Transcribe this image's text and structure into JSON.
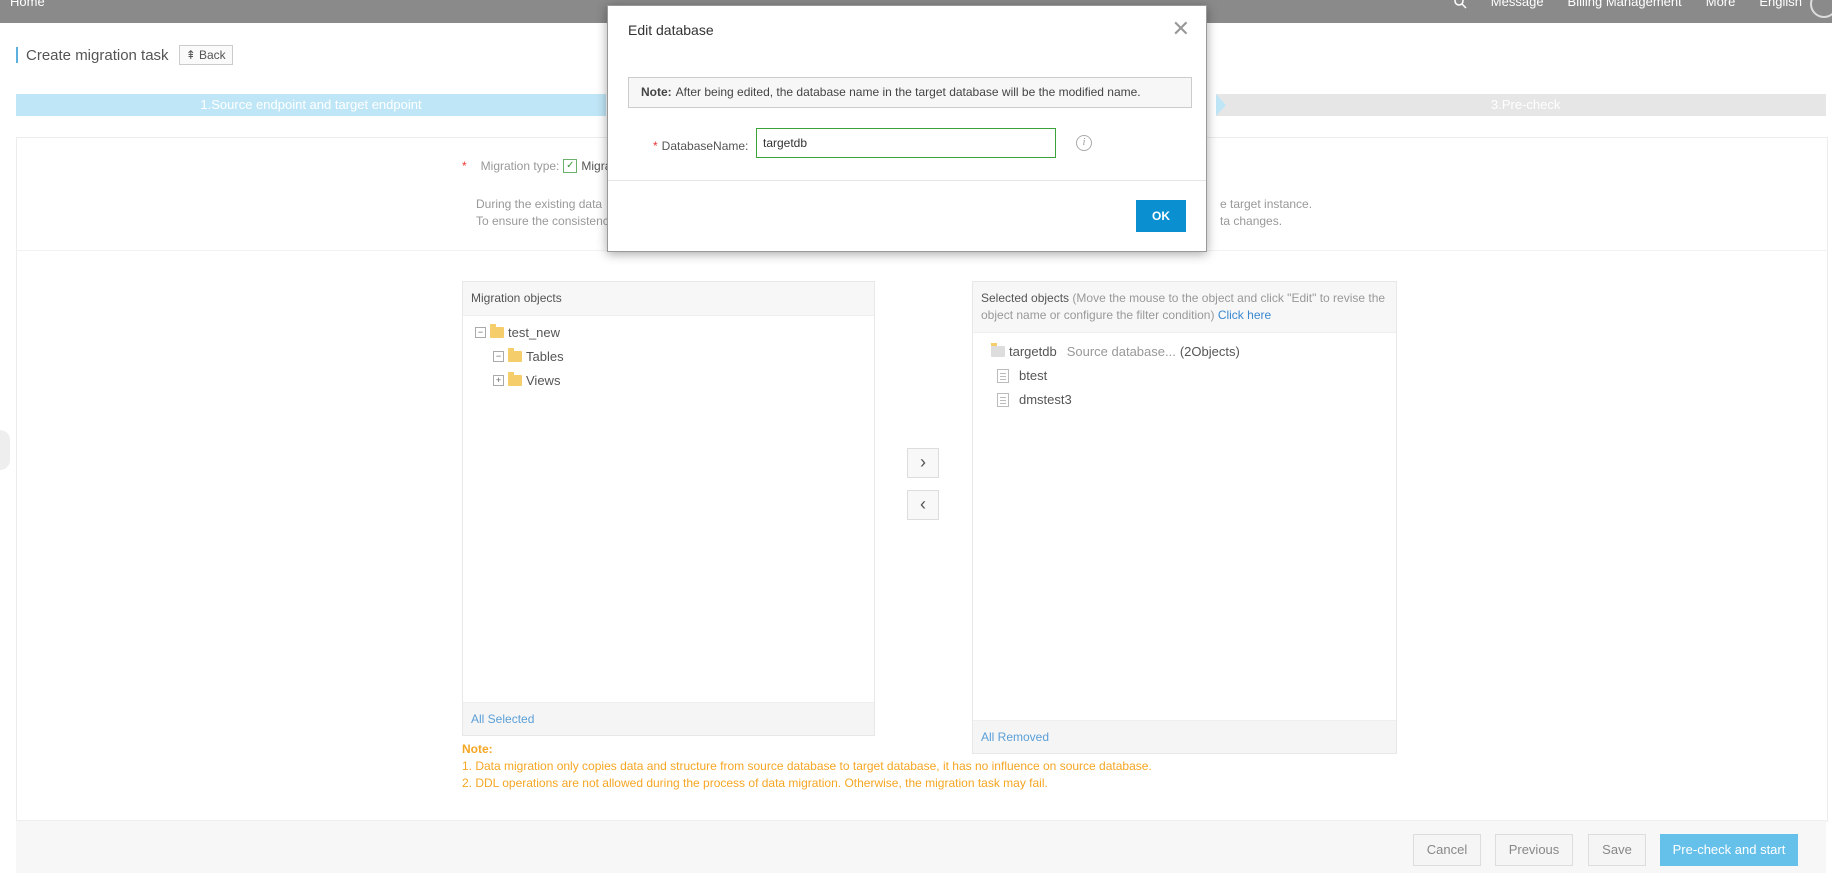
{
  "topbar": {
    "home": "Home",
    "message": "Message",
    "billing": "Billing Management",
    "more": "More",
    "language": "English"
  },
  "header": {
    "title": "Create migration task",
    "back": "Back"
  },
  "steps": {
    "step1": "1.Source endpoint and target endpoint",
    "step3": "3.Pre-check"
  },
  "migration": {
    "type_label": "Migration type:",
    "type_value": "Migra",
    "desc_line1": "During the existing data",
    "desc_line2": "To ensure the consistenc",
    "desc_right1": "e target instance.",
    "desc_right2": "ta changes."
  },
  "left_panel": {
    "title": "Migration objects",
    "tree": [
      {
        "label": "test_new",
        "expander": "−"
      },
      {
        "label": "Tables",
        "expander": "−"
      },
      {
        "label": "Views",
        "expander": "+"
      }
    ],
    "footer": "All Selected"
  },
  "right_panel": {
    "title": "Selected objects",
    "hint": "(Move the mouse to the object and click \"Edit\" to revise the object name or configure the filter condition)",
    "hint_link": "Click here",
    "db_name": "targetdb",
    "db_source": "Source database...",
    "db_count": "(2Objects)",
    "items": [
      "btest",
      "dmstest3"
    ],
    "footer": "All Removed"
  },
  "notes": {
    "title": "Note:",
    "line1": "1. Data migration only copies data and structure from source database to target database, it has no influence on source database.",
    "line2": "2. DDL operations are not allowed during the process of data migration. Otherwise, the migration task may fail."
  },
  "footer": {
    "cancel": "Cancel",
    "previous": "Previous",
    "save": "Save",
    "precheck": "Pre-check and start"
  },
  "modal": {
    "title": "Edit database",
    "note_label": "Note:",
    "note_text": "After being edited, the database name in the target database will be the modified name.",
    "field_label": "DatabaseName:",
    "field_value": "targetdb",
    "ok": "OK"
  }
}
